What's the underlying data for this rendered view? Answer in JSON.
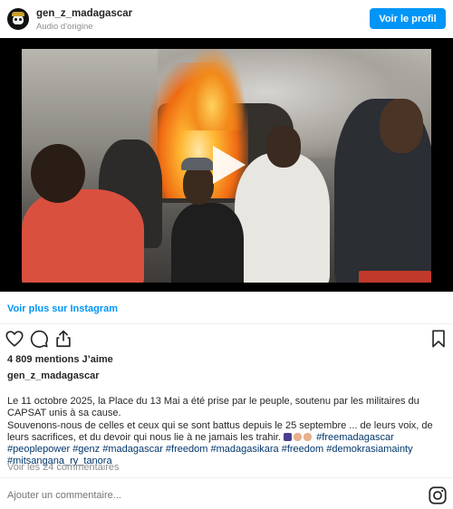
{
  "header": {
    "username": "gen_z_madagascar",
    "subtitle": "Audio d'origine",
    "profile_button": "Voir le profil"
  },
  "media": {
    "type": "video",
    "play_icon": "play-icon"
  },
  "links": {
    "see_more": "Voir plus sur Instagram"
  },
  "actions": {
    "like_icon": "heart-icon",
    "comment_icon": "comment-icon",
    "share_icon": "share-icon",
    "save_icon": "bookmark-icon"
  },
  "post": {
    "likes": "4 809 mentions J’aime",
    "caption_user": "gen_z_madagascar",
    "caption_line1": "Le 11 octobre 2025, la Place du 13 Mai a été prise par le peuple, soutenu par les militaires du CAPSAT unis à sa cause.",
    "caption_line2": "Souvenons-nous de celles et ceux qui se sont battus depuis le 25 septembre ... de leurs voix, de leurs sacrifices, et du devoir qui nous lie à ne jamais les trahir.",
    "caption_tags_inline": "#freemadagascar #peoplepower",
    "caption_tags": "#genz #madagascar #freedom #madagasikara #freedom #demokrasiamainty #mitsangana_ry_tanora",
    "view_comments": "Voir les 24 commentaires"
  },
  "comment_box": {
    "placeholder": "Ajouter un commentaire...",
    "instagram_icon": "instagram-icon"
  },
  "colors": {
    "accent": "#0095f6",
    "hashtag": "#00376b",
    "muted": "#8e8e8e",
    "text": "#262626"
  }
}
